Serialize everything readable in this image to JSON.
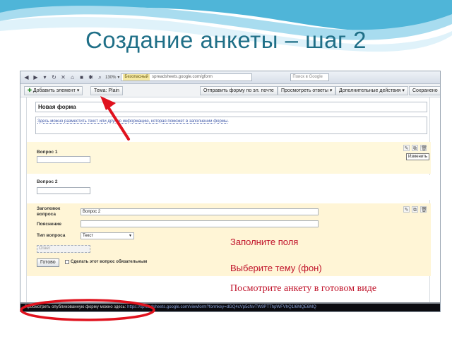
{
  "slide": {
    "title": "Создание анкеты – шаг 2",
    "accent": "#1f6f87",
    "annotation_color": "#c0132a"
  },
  "browser": {
    "zoom": "130%",
    "secure_label": "Безопасный",
    "url": "spreadsheets.google.com/gform",
    "search_placeholder": "Поиск в Google"
  },
  "toolbar": {
    "add_item": "Добавить элемент",
    "theme": "Тема: Plain",
    "send_form": "Отправить форму по эл. почте",
    "view_responses": "Просмотреть ответы",
    "more_actions": "Дополнительные действия",
    "saved": "Сохранено"
  },
  "form": {
    "title": "Новая форма",
    "description": "Здесь можно разместить текст или другую информацию, которая поможет в заполнении формы.",
    "question1": "Вопрос 1",
    "question2": "Вопрос 2",
    "edit_tooltip": "Изменить",
    "editor": {
      "header_label": "Заголовок вопроса",
      "header_value": "Вопрос 2",
      "hint_label": "Пояснение",
      "type_label": "Тип вопроса",
      "type_value": "Текст",
      "answer_placeholder": "Ответ",
      "done_button": "Готово",
      "required_label": "Сделать этот вопрос обязательным"
    }
  },
  "status": {
    "text": "Просмотреть опубликованную форму можно здесь:",
    "link": "https://spreadsheets.google.com/viewform?formkey=dGQ4cVp5cNvTW9PTThpWFVhQ1I6MQE6MQ"
  },
  "notes": {
    "fill_fields": "Заполните поля",
    "choose_theme": "Выберите тему (фон)",
    "view_ready": "Посмотрите анкету в готовом виде"
  }
}
